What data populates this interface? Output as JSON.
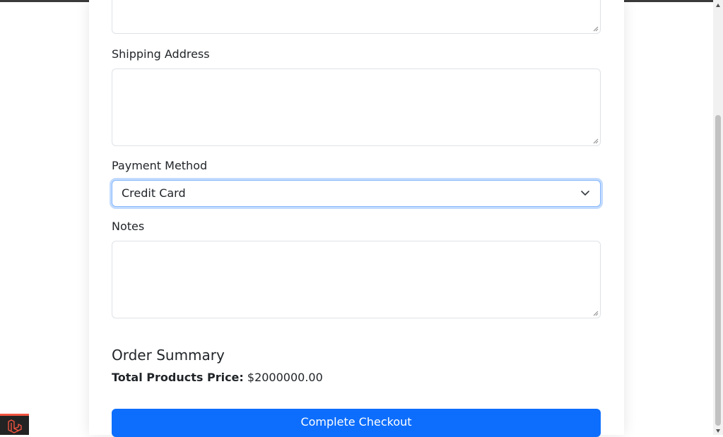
{
  "form": {
    "shipping_label": "Shipping Address",
    "payment_label": "Payment Method",
    "payment_selected": "Credit Card",
    "notes_label": "Notes"
  },
  "summary": {
    "heading": "Order Summary",
    "total_label": "Total Products Price:",
    "total_value": "$2000000.00"
  },
  "actions": {
    "checkout_label": "Complete Checkout"
  },
  "colors": {
    "primary": "#0d6efd",
    "focus_border": "#86b7fe",
    "laravel_red": "#f05340"
  },
  "icons": {
    "select": "chevron-down-icon",
    "badge": "laravel-logo-icon"
  }
}
